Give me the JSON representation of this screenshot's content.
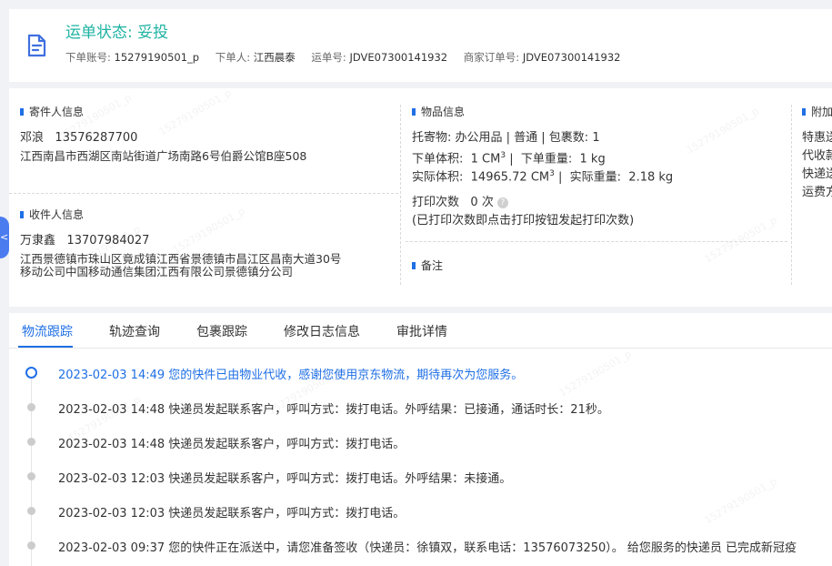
{
  "header": {
    "status_label": "运单状态:",
    "status_value": "妥投",
    "meta": [
      {
        "key": "下单账号:",
        "value": "15279190501_p"
      },
      {
        "key": "下单人:",
        "value": "江西晨泰"
      },
      {
        "key": "运单号:",
        "value": "JDVE07300141932"
      },
      {
        "key": "商家订单号:",
        "value": "JDVE07300141932"
      }
    ]
  },
  "sender": {
    "title": "寄件人信息",
    "name": "邓浪",
    "phone": "13576287700",
    "address": "江西南昌市西湖区南站街道广场南路6号伯爵公馆B座508"
  },
  "receiver": {
    "title": "收件人信息",
    "name": "万隶鑫",
    "phone": "13707984027",
    "address_line1": "江西景德镇市珠山区竟成镇江西省景德镇市昌江区昌南大道30号",
    "address_line2": "移动公司中国移动通信集团江西有限公司景德镇分公司"
  },
  "goods": {
    "title": "物品信息",
    "line1": "托寄物:  办公用品 | 普通  |  包裹数:  1",
    "order_volume_label": "下单体积:",
    "order_volume_value": "1 CM",
    "order_weight_label": "下单重量:",
    "order_weight_value": "1 kg",
    "actual_volume_label": "实际体积:",
    "actual_volume_value": "14965.72 CM",
    "actual_weight_label": "实际重量:",
    "actual_weight_value": "2.18 kg",
    "cube_exp": "3",
    "print_count_label": "打印次数",
    "print_count_value": "0 次",
    "print_note": "(已打印次数即点击打印按钮发起打印次数)"
  },
  "remark": {
    "title": "备注"
  },
  "extra": {
    "title": "附加",
    "lines": [
      "特惠送",
      "代收款",
      "快递送",
      "运费方"
    ]
  },
  "side_tab": {
    "glyph": "<"
  },
  "tabs": [
    "物流跟踪",
    "轨迹查询",
    "包裹跟踪",
    "修改日志信息",
    "审批详情"
  ],
  "tracking": [
    {
      "time": "2023-02-03 14:49",
      "text": "您的快件已由物业代收，感谢您使用京东物流，期待再次为您服务。",
      "current": true
    },
    {
      "time": "2023-02-03 14:48",
      "text": "快递员发起联系客户，呼叫方式：拨打电话。外呼结果：已接通，通话时长：21秒。",
      "current": false
    },
    {
      "time": "2023-02-03 14:48",
      "text": "快递员发起联系客户，呼叫方式：拨打电话。",
      "current": false
    },
    {
      "time": "2023-02-03 12:03",
      "text": "快递员发起联系客户，呼叫方式：拨打电话。外呼结果：未接通。",
      "current": false
    },
    {
      "time": "2023-02-03 12:03",
      "text": "快递员发起联系客户，呼叫方式：拨打电话。",
      "current": false
    },
    {
      "time": "2023-02-03 09:37",
      "text": "您的快件正在派送中，请您准备签收（快递员：徐镇双，联系电话：13576073250）。 给您服务的快递员 已完成新冠疫",
      "current": false
    }
  ],
  "watermark": "15279190501_p",
  "colors": {
    "accent": "#1f6fe5",
    "status_green": "#1fb3a3"
  }
}
